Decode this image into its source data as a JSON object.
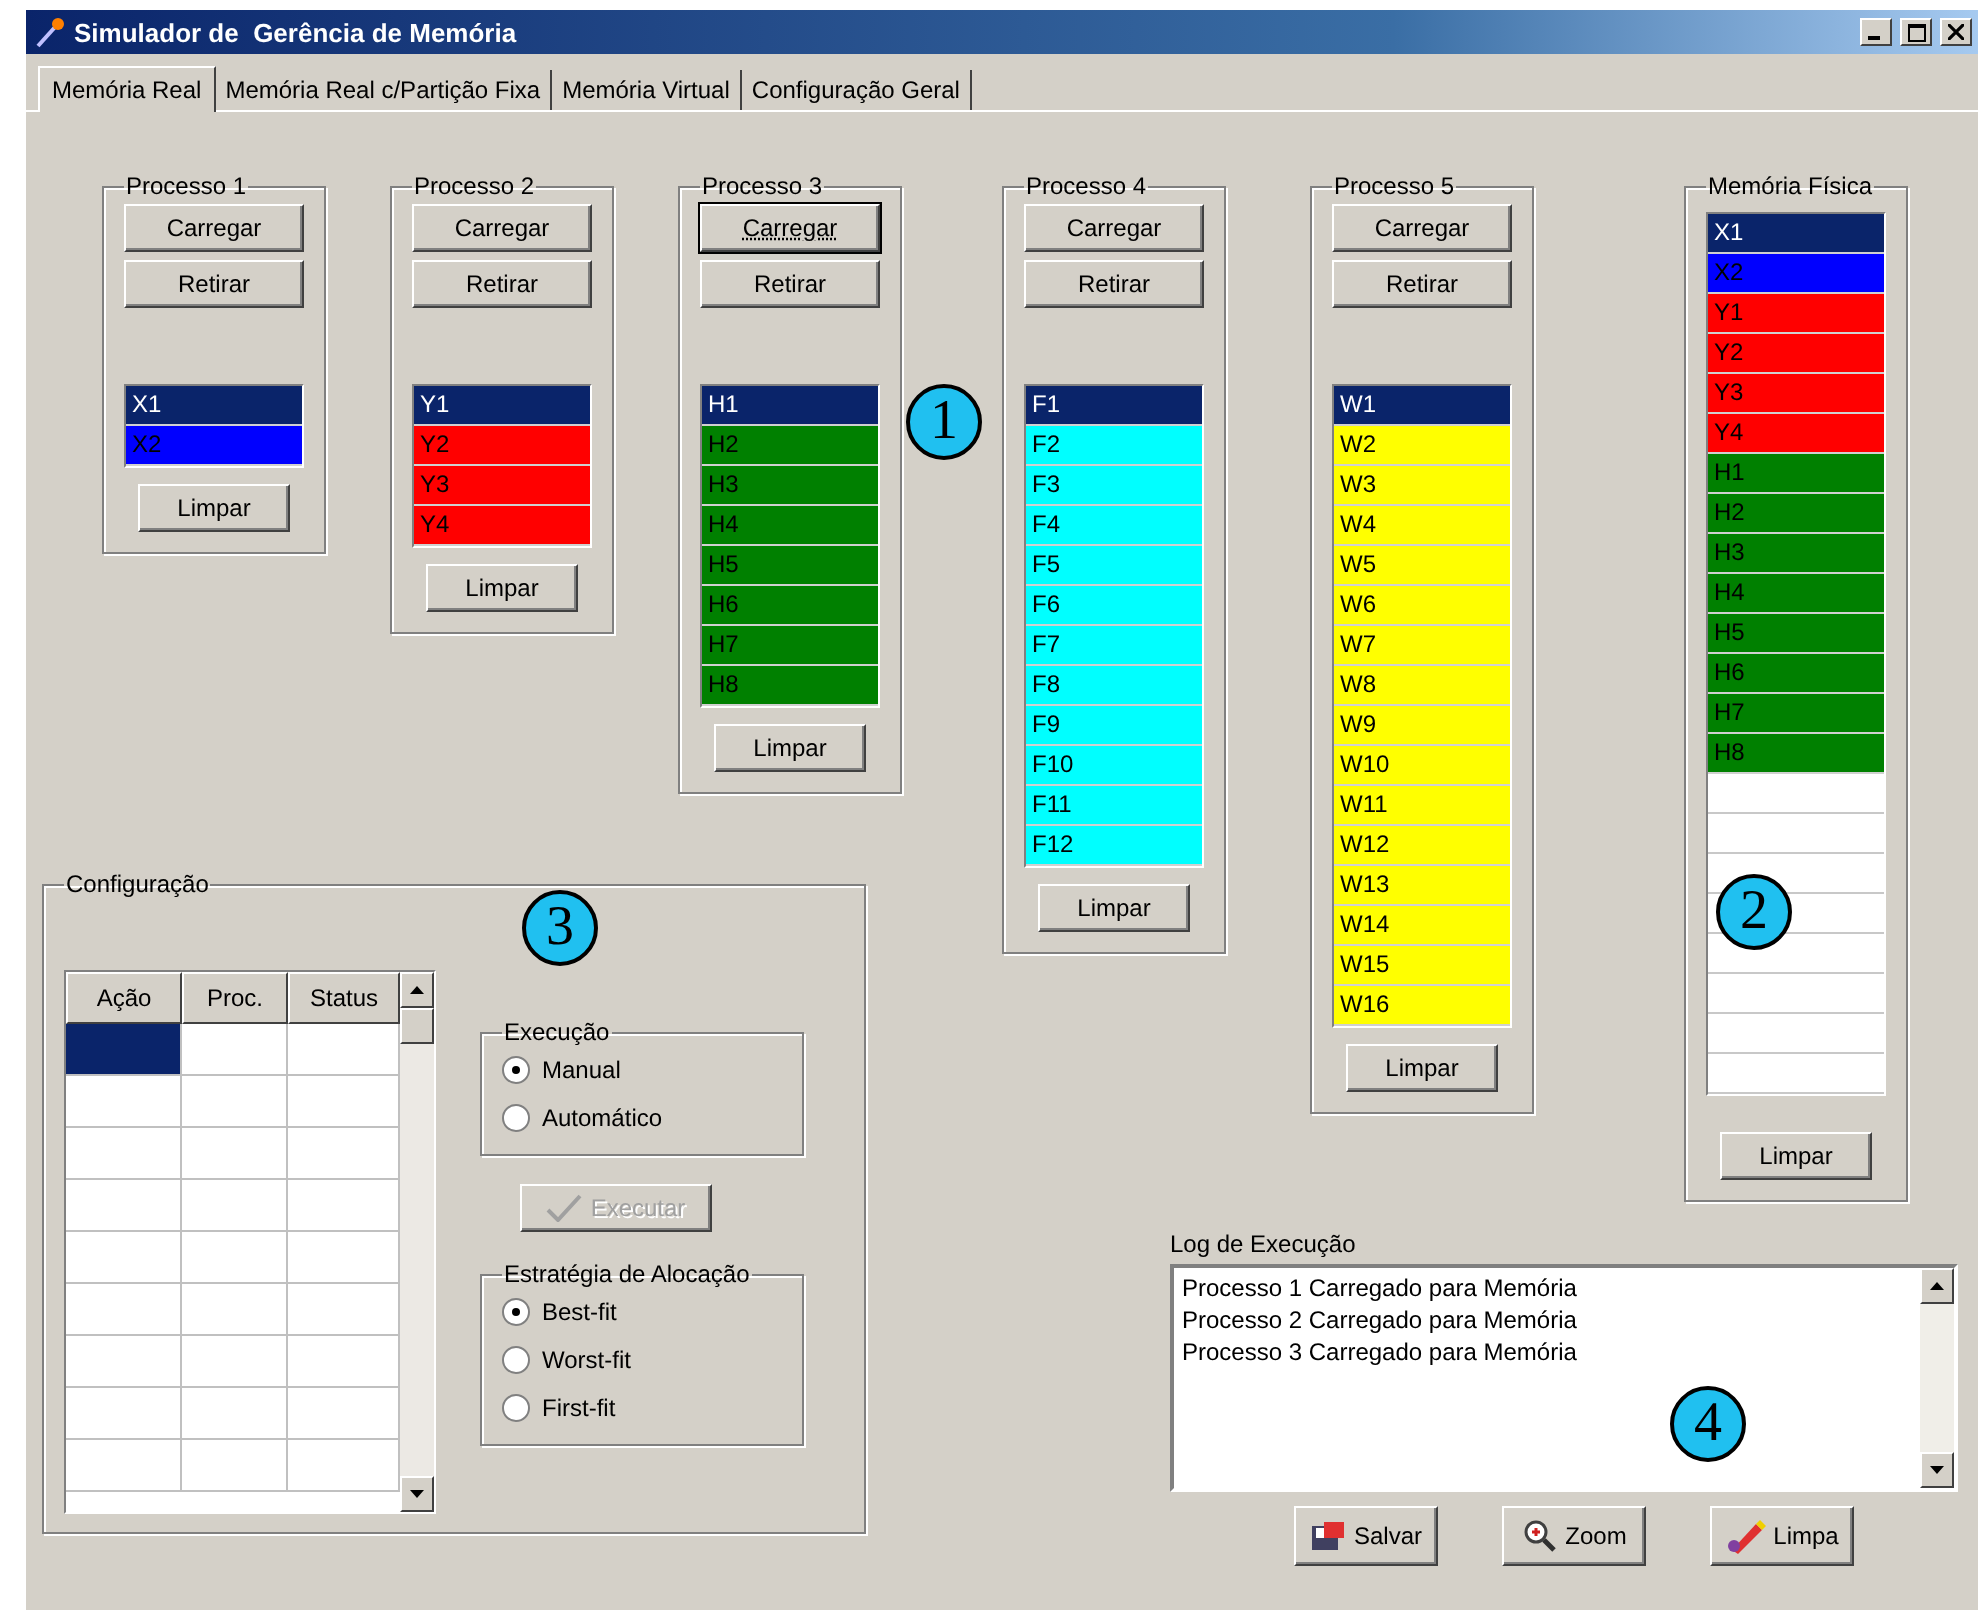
{
  "window": {
    "title": "Simulador de  Gerência de Memória"
  },
  "tabs": [
    {
      "label": "Memória Real",
      "selected": true
    },
    {
      "label": "Memória Real c/Partição Fixa",
      "selected": false
    },
    {
      "label": "Memória Virtual",
      "selected": false
    },
    {
      "label": "Configuração Geral",
      "selected": false
    }
  ],
  "processes": [
    {
      "title": "Processo 1",
      "load_button": "Carregar",
      "remove_button": "Retirar",
      "clear_button": "Limpar",
      "focused": false,
      "pages": [
        {
          "label": "X1",
          "selected": true
        },
        {
          "label": "X2",
          "color": "#0000ff",
          "selected": false
        }
      ]
    },
    {
      "title": "Processo 2",
      "load_button": "Carregar",
      "remove_button": "Retirar",
      "clear_button": "Limpar",
      "focused": false,
      "pages": [
        {
          "label": "Y1",
          "selected": true
        },
        {
          "label": "Y2",
          "color": "#ff0000",
          "selected": false
        },
        {
          "label": "Y3",
          "color": "#ff0000",
          "selected": false
        },
        {
          "label": "Y4",
          "color": "#ff0000",
          "selected": false
        }
      ]
    },
    {
      "title": "Processo 3",
      "load_button": "Carregar",
      "remove_button": "Retirar",
      "clear_button": "Limpar",
      "focused": true,
      "pages": [
        {
          "label": "H1",
          "selected": true
        },
        {
          "label": "H2",
          "color": "#008000",
          "selected": false
        },
        {
          "label": "H3",
          "color": "#008000",
          "selected": false
        },
        {
          "label": "H4",
          "color": "#008000",
          "selected": false
        },
        {
          "label": "H5",
          "color": "#008000",
          "selected": false
        },
        {
          "label": "H6",
          "color": "#008000",
          "selected": false
        },
        {
          "label": "H7",
          "color": "#008000",
          "selected": false
        },
        {
          "label": "H8",
          "color": "#008000",
          "selected": false
        }
      ]
    },
    {
      "title": "Processo 4",
      "load_button": "Carregar",
      "remove_button": "Retirar",
      "clear_button": "Limpar",
      "focused": false,
      "pages": [
        {
          "label": "F1",
          "selected": true
        },
        {
          "label": "F2",
          "color": "#00ffff",
          "selected": false
        },
        {
          "label": "F3",
          "color": "#00ffff",
          "selected": false
        },
        {
          "label": "F4",
          "color": "#00ffff",
          "selected": false
        },
        {
          "label": "F5",
          "color": "#00ffff",
          "selected": false
        },
        {
          "label": "F6",
          "color": "#00ffff",
          "selected": false
        },
        {
          "label": "F7",
          "color": "#00ffff",
          "selected": false
        },
        {
          "label": "F8",
          "color": "#00ffff",
          "selected": false
        },
        {
          "label": "F9",
          "color": "#00ffff",
          "selected": false
        },
        {
          "label": "F10",
          "color": "#00ffff",
          "selected": false
        },
        {
          "label": "F11",
          "color": "#00ffff",
          "selected": false
        },
        {
          "label": "F12",
          "color": "#00ffff",
          "selected": false
        }
      ]
    },
    {
      "title": "Processo 5",
      "load_button": "Carregar",
      "remove_button": "Retirar",
      "clear_button": "Limpar",
      "focused": false,
      "pages": [
        {
          "label": "W1",
          "selected": true
        },
        {
          "label": "W2",
          "color": "#ffff00",
          "selected": false
        },
        {
          "label": "W3",
          "color": "#ffff00",
          "selected": false
        },
        {
          "label": "W4",
          "color": "#ffff00",
          "selected": false
        },
        {
          "label": "W5",
          "color": "#ffff00",
          "selected": false
        },
        {
          "label": "W6",
          "color": "#ffff00",
          "selected": false
        },
        {
          "label": "W7",
          "color": "#ffff00",
          "selected": false
        },
        {
          "label": "W8",
          "color": "#ffff00",
          "selected": false
        },
        {
          "label": "W9",
          "color": "#ffff00",
          "selected": false
        },
        {
          "label": "W10",
          "color": "#ffff00",
          "selected": false
        },
        {
          "label": "W11",
          "color": "#ffff00",
          "selected": false
        },
        {
          "label": "W12",
          "color": "#ffff00",
          "selected": false
        },
        {
          "label": "W13",
          "color": "#ffff00",
          "selected": false
        },
        {
          "label": "W14",
          "color": "#ffff00",
          "selected": false
        },
        {
          "label": "W15",
          "color": "#ffff00",
          "selected": false
        },
        {
          "label": "W16",
          "color": "#ffff00",
          "selected": false
        }
      ]
    }
  ],
  "physical_memory": {
    "title": "Memória Física",
    "clear_button": "Limpar",
    "blocks": [
      {
        "kind": "used",
        "label": "X1",
        "selected": true
      },
      {
        "kind": "used",
        "label": "X2",
        "color": "#0000ff",
        "selected": false
      },
      {
        "kind": "used",
        "label": "Y1",
        "color": "#ff0000",
        "selected": false
      },
      {
        "kind": "used",
        "label": "Y2",
        "color": "#ff0000",
        "selected": false
      },
      {
        "kind": "used",
        "label": "Y3",
        "color": "#ff0000",
        "selected": false
      },
      {
        "kind": "used",
        "label": "Y4",
        "color": "#ff0000",
        "selected": false
      },
      {
        "kind": "used",
        "label": "H1",
        "color": "#008000",
        "selected": false
      },
      {
        "kind": "used",
        "label": "H2",
        "color": "#008000",
        "selected": false
      },
      {
        "kind": "used",
        "label": "H3",
        "color": "#008000",
        "selected": false
      },
      {
        "kind": "used",
        "label": "H4",
        "color": "#008000",
        "selected": false
      },
      {
        "kind": "used",
        "label": "H5",
        "color": "#008000",
        "selected": false
      },
      {
        "kind": "used",
        "label": "H6",
        "color": "#008000",
        "selected": false
      },
      {
        "kind": "used",
        "label": "H7",
        "color": "#008000",
        "selected": false
      },
      {
        "kind": "used",
        "label": "H8",
        "color": "#008000",
        "selected": false
      },
      {
        "kind": "free"
      },
      {
        "kind": "free"
      },
      {
        "kind": "free"
      },
      {
        "kind": "free"
      },
      {
        "kind": "free"
      },
      {
        "kind": "free"
      },
      {
        "kind": "free"
      },
      {
        "kind": "free"
      }
    ]
  },
  "configuration": {
    "title": "Configuração",
    "table": {
      "columns": [
        "Ação",
        "Proc.",
        "Status"
      ],
      "rows": [
        {
          "selected": true
        },
        {
          "selected": false
        },
        {
          "selected": false
        },
        {
          "selected": false
        },
        {
          "selected": false
        },
        {
          "selected": false
        },
        {
          "selected": false
        },
        {
          "selected": false
        },
        {
          "selected": false
        }
      ]
    },
    "execution": {
      "title": "Execução",
      "options": [
        {
          "label": "Manual",
          "selected": true
        },
        {
          "label": "Automático",
          "selected": false
        }
      ]
    },
    "run_button": {
      "label": "Executar",
      "disabled": true
    },
    "strategy": {
      "title": "Estratégia de Alocação",
      "options": [
        {
          "label": "Best-fit",
          "selected": true
        },
        {
          "label": "Worst-fit",
          "selected": false
        },
        {
          "label": "First-fit",
          "selected": false
        }
      ]
    }
  },
  "log": {
    "title": "Log de Execução",
    "lines": [
      "Processo 1 Carregado para Memória",
      "Processo 2 Carregado para Memória",
      "Processo 3 Carregado para Memória"
    ],
    "buttons": [
      {
        "kind": "save",
        "label": "Salvar"
      },
      {
        "kind": "zoom",
        "label": "Zoom"
      },
      {
        "kind": "clear",
        "label": "Limpa"
      }
    ]
  },
  "markers": [
    {
      "label": "1"
    },
    {
      "label": "2"
    },
    {
      "label": "3"
    },
    {
      "label": "4"
    }
  ]
}
